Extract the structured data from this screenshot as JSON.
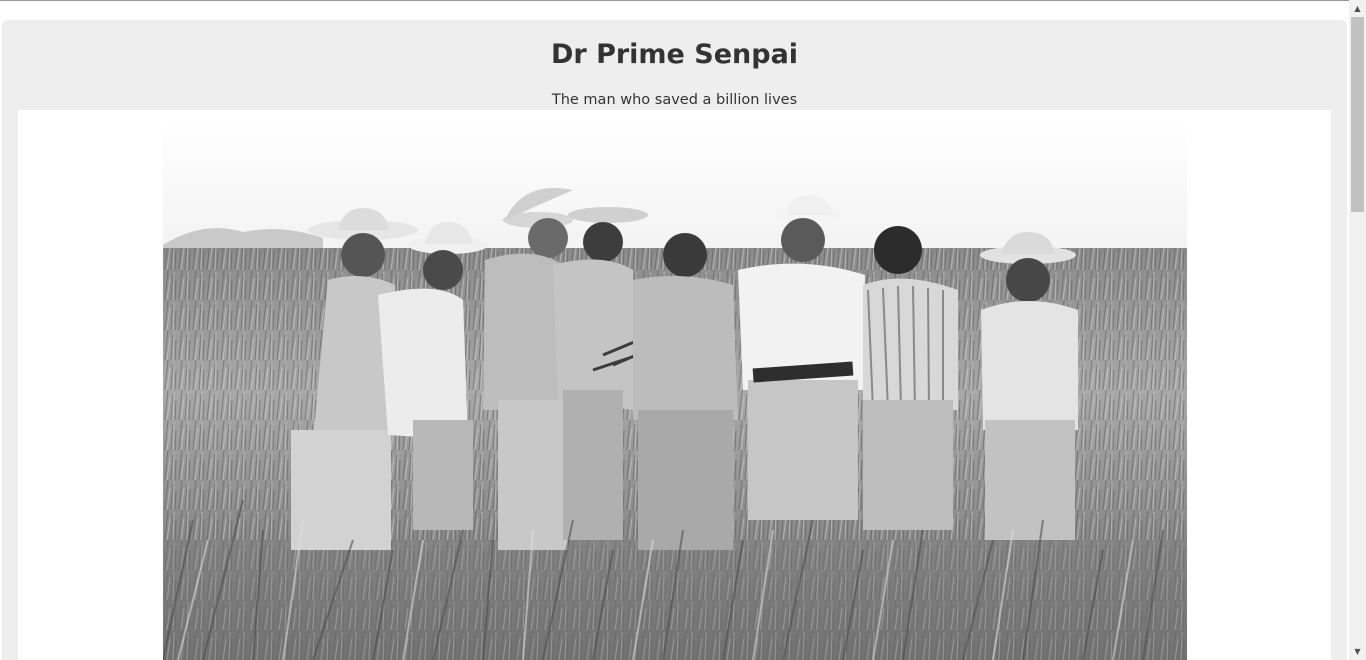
{
  "page": {
    "title": "Dr Prime Senpai",
    "subtitle": "The man who saved a billion lives"
  },
  "image": {
    "name": "black-and-white photo of men in straw hats standing in a wheat field examining wheat stalks",
    "style": "grayscale"
  },
  "colors": {
    "jumbotron_bg": "#eeeeee",
    "text": "#333333",
    "scrollbar_track": "#f1f1f1",
    "scrollbar_thumb": "#c1c1c1"
  },
  "icons": {
    "scroll_up": "triangle-up-icon",
    "scroll_down": "triangle-down-icon"
  }
}
